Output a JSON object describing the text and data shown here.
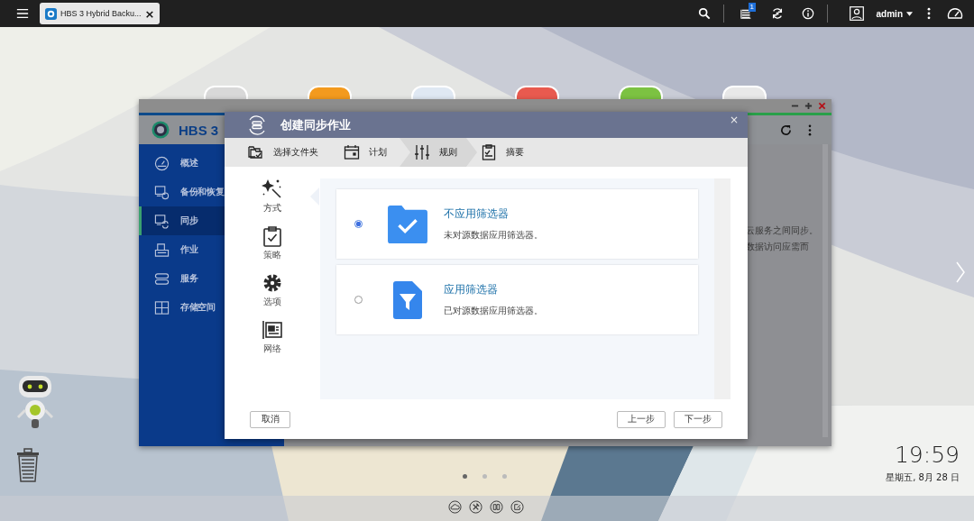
{
  "top_bar": {
    "tab": {
      "title": "HBS 3 Hybrid Backu...",
      "close": "×"
    },
    "notification_count": "1",
    "user": "admin"
  },
  "background_window": {
    "app_name": "HBS 3",
    "sidebar": [
      {
        "label": "概述",
        "kind": "gauge",
        "selected": false
      },
      {
        "label": "备份和恢复",
        "kind": "backup",
        "selected": false
      },
      {
        "label": "同步",
        "kind": "sync",
        "selected": true
      },
      {
        "label": "作业",
        "kind": "jobs",
        "selected": false
      },
      {
        "label": "服务",
        "kind": "services",
        "selected": false
      },
      {
        "label": "存储空间",
        "kind": "storage",
        "selected": false
      }
    ],
    "content_lines": [
      "云服务之间同步。",
      "数据访问应需而"
    ]
  },
  "dialog": {
    "title": "创建同步作业",
    "close": "×",
    "steps": [
      {
        "label": "选择文件夹",
        "kind": "folder",
        "selected": false
      },
      {
        "label": "计划",
        "kind": "calendar",
        "selected": false
      },
      {
        "label": "规则",
        "kind": "sliders",
        "selected": true
      },
      {
        "label": "摘要",
        "kind": "summary",
        "selected": false
      }
    ],
    "nav": [
      {
        "label": "方式",
        "kind": "wand",
        "selected": true
      },
      {
        "label": "策略",
        "kind": "clipboard",
        "selected": false
      },
      {
        "label": "选项",
        "kind": "gear",
        "selected": false
      },
      {
        "label": "网络",
        "kind": "network",
        "selected": false
      }
    ],
    "options": [
      {
        "title": "不应用筛选器",
        "description": "未对源数据应用筛选器。",
        "kind": "folder",
        "selected": true
      },
      {
        "title": "应用筛选器",
        "description": "已对源数据应用筛选器。",
        "kind": "filter",
        "selected": false
      }
    ],
    "cancel": "取消",
    "back": "上一步",
    "next": "下一步"
  },
  "desktop": {
    "time": "19:59",
    "date": "星期五, 8月 28 日",
    "pages": [
      {
        "selected": true
      },
      {
        "selected": false
      },
      {
        "selected": false
      }
    ]
  }
}
